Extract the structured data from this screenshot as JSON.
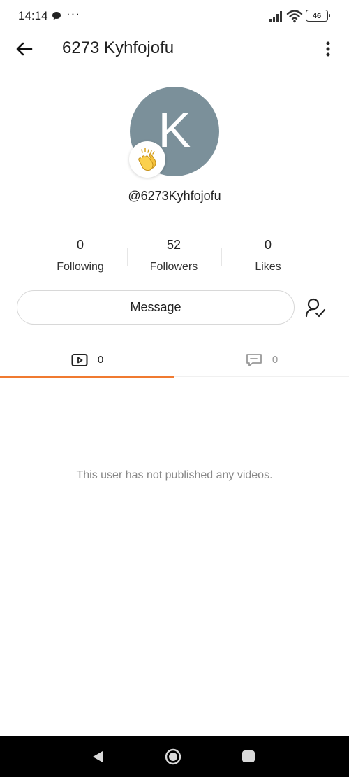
{
  "status_bar": {
    "time": "14:14",
    "dots": "···",
    "battery": "46"
  },
  "header": {
    "title": "6273 Kyhfojofu"
  },
  "profile": {
    "avatar_letter": "K",
    "avatar_color": "#7b909a",
    "badge_emoji": "👏",
    "handle": "@6273Kyhfojofu"
  },
  "stats": [
    {
      "value": "0",
      "label": "Following"
    },
    {
      "value": "52",
      "label": "Followers"
    },
    {
      "value": "0",
      "label": "Likes"
    }
  ],
  "actions": {
    "message_label": "Message"
  },
  "tabs": [
    {
      "icon": "video-icon",
      "count": "0",
      "active": true
    },
    {
      "icon": "comment-icon",
      "count": "0",
      "active": false
    }
  ],
  "content": {
    "empty_message": "This user has not published any videos."
  },
  "colors": {
    "accent": "#f07a30"
  }
}
